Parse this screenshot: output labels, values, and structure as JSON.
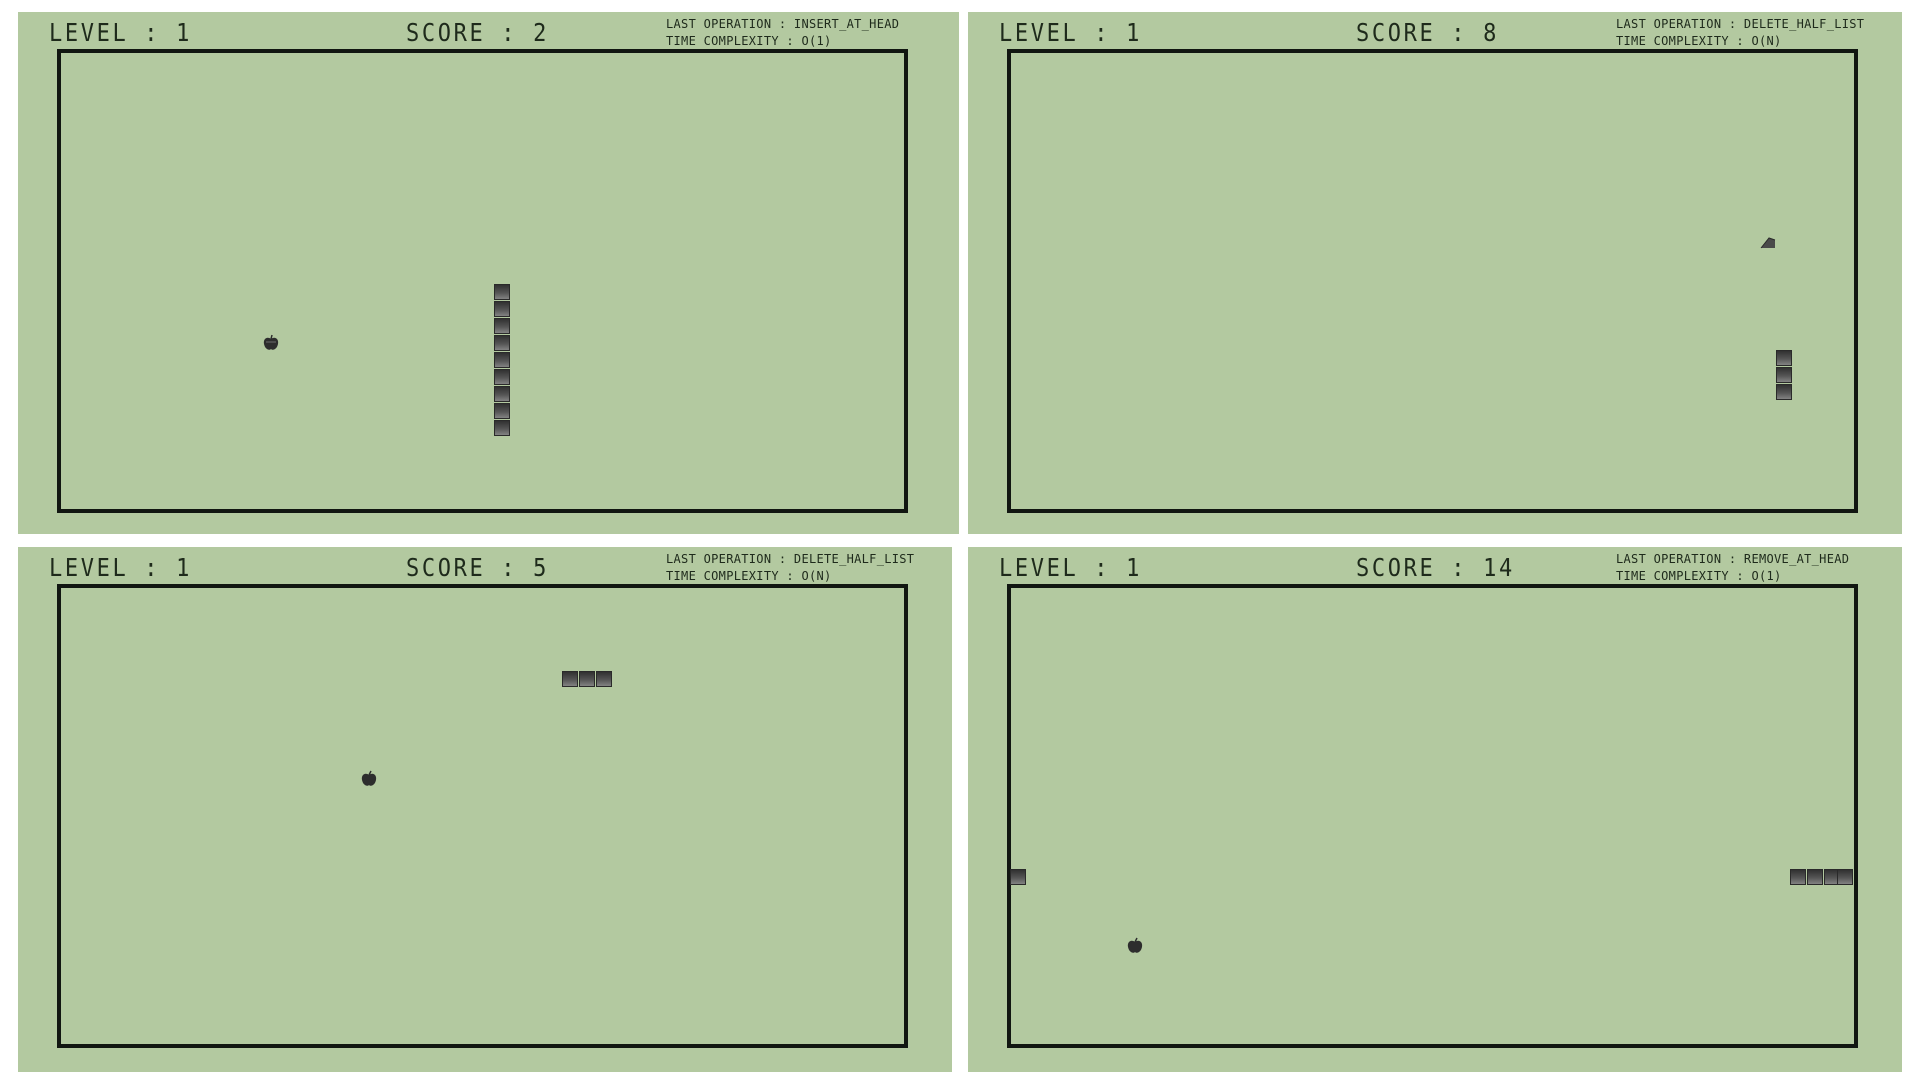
{
  "panels": [
    {
      "level": "LEVEL : 1",
      "score": "SCORE : 2",
      "last_operation": "LAST OPERATION : INSERT_AT_HEAD",
      "time_complexity": "TIME COMPLEXITY : O(1)",
      "food_icon": "apple-icon"
    },
    {
      "level": "LEVEL : 1",
      "score": "SCORE : 8",
      "last_operation": "LAST OPERATION : DELETE_HALF_LIST",
      "time_complexity": "TIME COMPLEXITY : O(N)",
      "food_icon": "cheese-icon"
    },
    {
      "level": "LEVEL : 1",
      "score": "SCORE : 5",
      "last_operation": "LAST OPERATION : DELETE_HALF_LIST",
      "time_complexity": "TIME COMPLEXITY : O(N)",
      "food_icon": "apple-icon"
    },
    {
      "level": "LEVEL : 1",
      "score": "SCORE : 14",
      "last_operation": "LAST OPERATION : REMOVE_AT_HEAD",
      "time_complexity": "TIME COMPLEXITY : O(1)",
      "food_icon": "apple-icon"
    }
  ],
  "colors": {
    "screen_background": "#b3c9a0",
    "border": "#111611",
    "text": "#1e2a1b",
    "snake_dark": "#2c2c2c",
    "snake_light": "#8a8a8a"
  }
}
